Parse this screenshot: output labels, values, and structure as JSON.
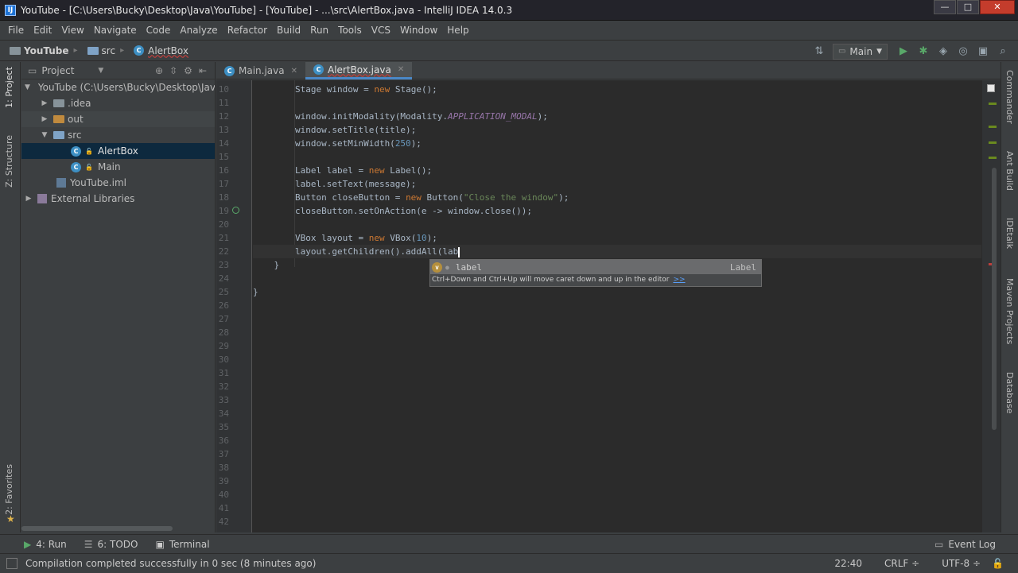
{
  "window": {
    "title": "YouTube - [C:\\Users\\Bucky\\Desktop\\Java\\YouTube] - [YouTube] - ...\\src\\AlertBox.java - IntelliJ IDEA 14.0.3",
    "minimize": "—",
    "maximize": "□",
    "close": "✕"
  },
  "menu": [
    "File",
    "Edit",
    "View",
    "Navigate",
    "Code",
    "Analyze",
    "Refactor",
    "Build",
    "Run",
    "Tools",
    "VCS",
    "Window",
    "Help"
  ],
  "breadcrumb": {
    "project": "YouTube",
    "folder": "src",
    "file": "AlertBox"
  },
  "toolbar": {
    "run_config": "Main"
  },
  "project_panel": {
    "title": "Project",
    "items": [
      {
        "label": "YouTube (C:\\Users\\Bucky\\Desktop\\Java",
        "depth": 0,
        "expanded": "▼"
      },
      {
        "label": ".idea",
        "depth": 1,
        "expanded": "▶"
      },
      {
        "label": "out",
        "depth": 1,
        "expanded": "▶"
      },
      {
        "label": "src",
        "depth": 1,
        "expanded": "▼"
      },
      {
        "label": "AlertBox",
        "depth": 2,
        "expanded": ""
      },
      {
        "label": "Main",
        "depth": 2,
        "expanded": ""
      },
      {
        "label": "YouTube.iml",
        "depth": 1,
        "expanded": ""
      },
      {
        "label": "External Libraries",
        "depth": 0,
        "expanded": "▶"
      }
    ]
  },
  "left_tabs": {
    "project": "1: Project",
    "structure": "Z: Structure",
    "favorites": "2: Favorites"
  },
  "right_tabs": {
    "commander": "Commander",
    "ant": "Ant Build",
    "idetalk": "IDEtalk",
    "maven": "Maven Projects",
    "database": "Database"
  },
  "editor_tabs": [
    {
      "label": "Main.java",
      "active": false
    },
    {
      "label": "AlertBox.java",
      "active": true
    }
  ],
  "editor": {
    "line_numbers": [
      "10",
      "11",
      "12",
      "13",
      "14",
      "15",
      "16",
      "17",
      "18",
      "19",
      "20",
      "21",
      "22",
      "23",
      "24",
      "25",
      "26",
      "27",
      "28",
      "29",
      "30",
      "31",
      "32",
      "33",
      "34",
      "35",
      "36",
      "37",
      "38",
      "39",
      "40",
      "41",
      "42"
    ],
    "code": {
      "l10a": "        Stage window = ",
      "l10kw": "new",
      "l10b": " Stage();",
      "l12a": "        window.initModality(Modality.",
      "l12f": "APPLICATION_MODAL",
      "l12b": ");",
      "l13": "        window.setTitle(title);",
      "l14a": "        window.setMinWidth(",
      "l14n": "250",
      "l14b": ");",
      "l16a": "        Label label = ",
      "l16kw": "new",
      "l16b": " Label();",
      "l17": "        label.setText(message);",
      "l18a": "        Button closeButton = ",
      "l18kw": "new",
      "l18b": " Button(",
      "l18s": "\"Close the window\"",
      "l18c": ");",
      "l19": "        closeButton.setOnAction(e -> window.close());",
      "l21a": "        VBox layout = ",
      "l21kw": "new",
      "l21b": " VBox(",
      "l21n": "10",
      "l21c": ");",
      "l22": "        layout.getChildren().addAll(lab",
      "l23": "    }",
      "l25": "}"
    }
  },
  "completion": {
    "item": "label",
    "type": "Label",
    "hint": "Ctrl+Down and Ctrl+Up will move caret down and up in the editor",
    "hint_link": ">>"
  },
  "bottom_tools": {
    "run": "4: Run",
    "todo": "6: TODO",
    "terminal": "Terminal",
    "event_log": "Event Log"
  },
  "status": {
    "message": "Compilation completed successfully in 0 sec (8 minutes ago)",
    "position": "22:40",
    "line_sep": "CRLF",
    "encoding": "UTF-8"
  },
  "colors": {
    "keyword": "#cc7832",
    "string": "#6a8759",
    "number": "#6897bb",
    "field": "#9876aa",
    "selection": "#0d293e",
    "accent": "#4a88c7"
  }
}
